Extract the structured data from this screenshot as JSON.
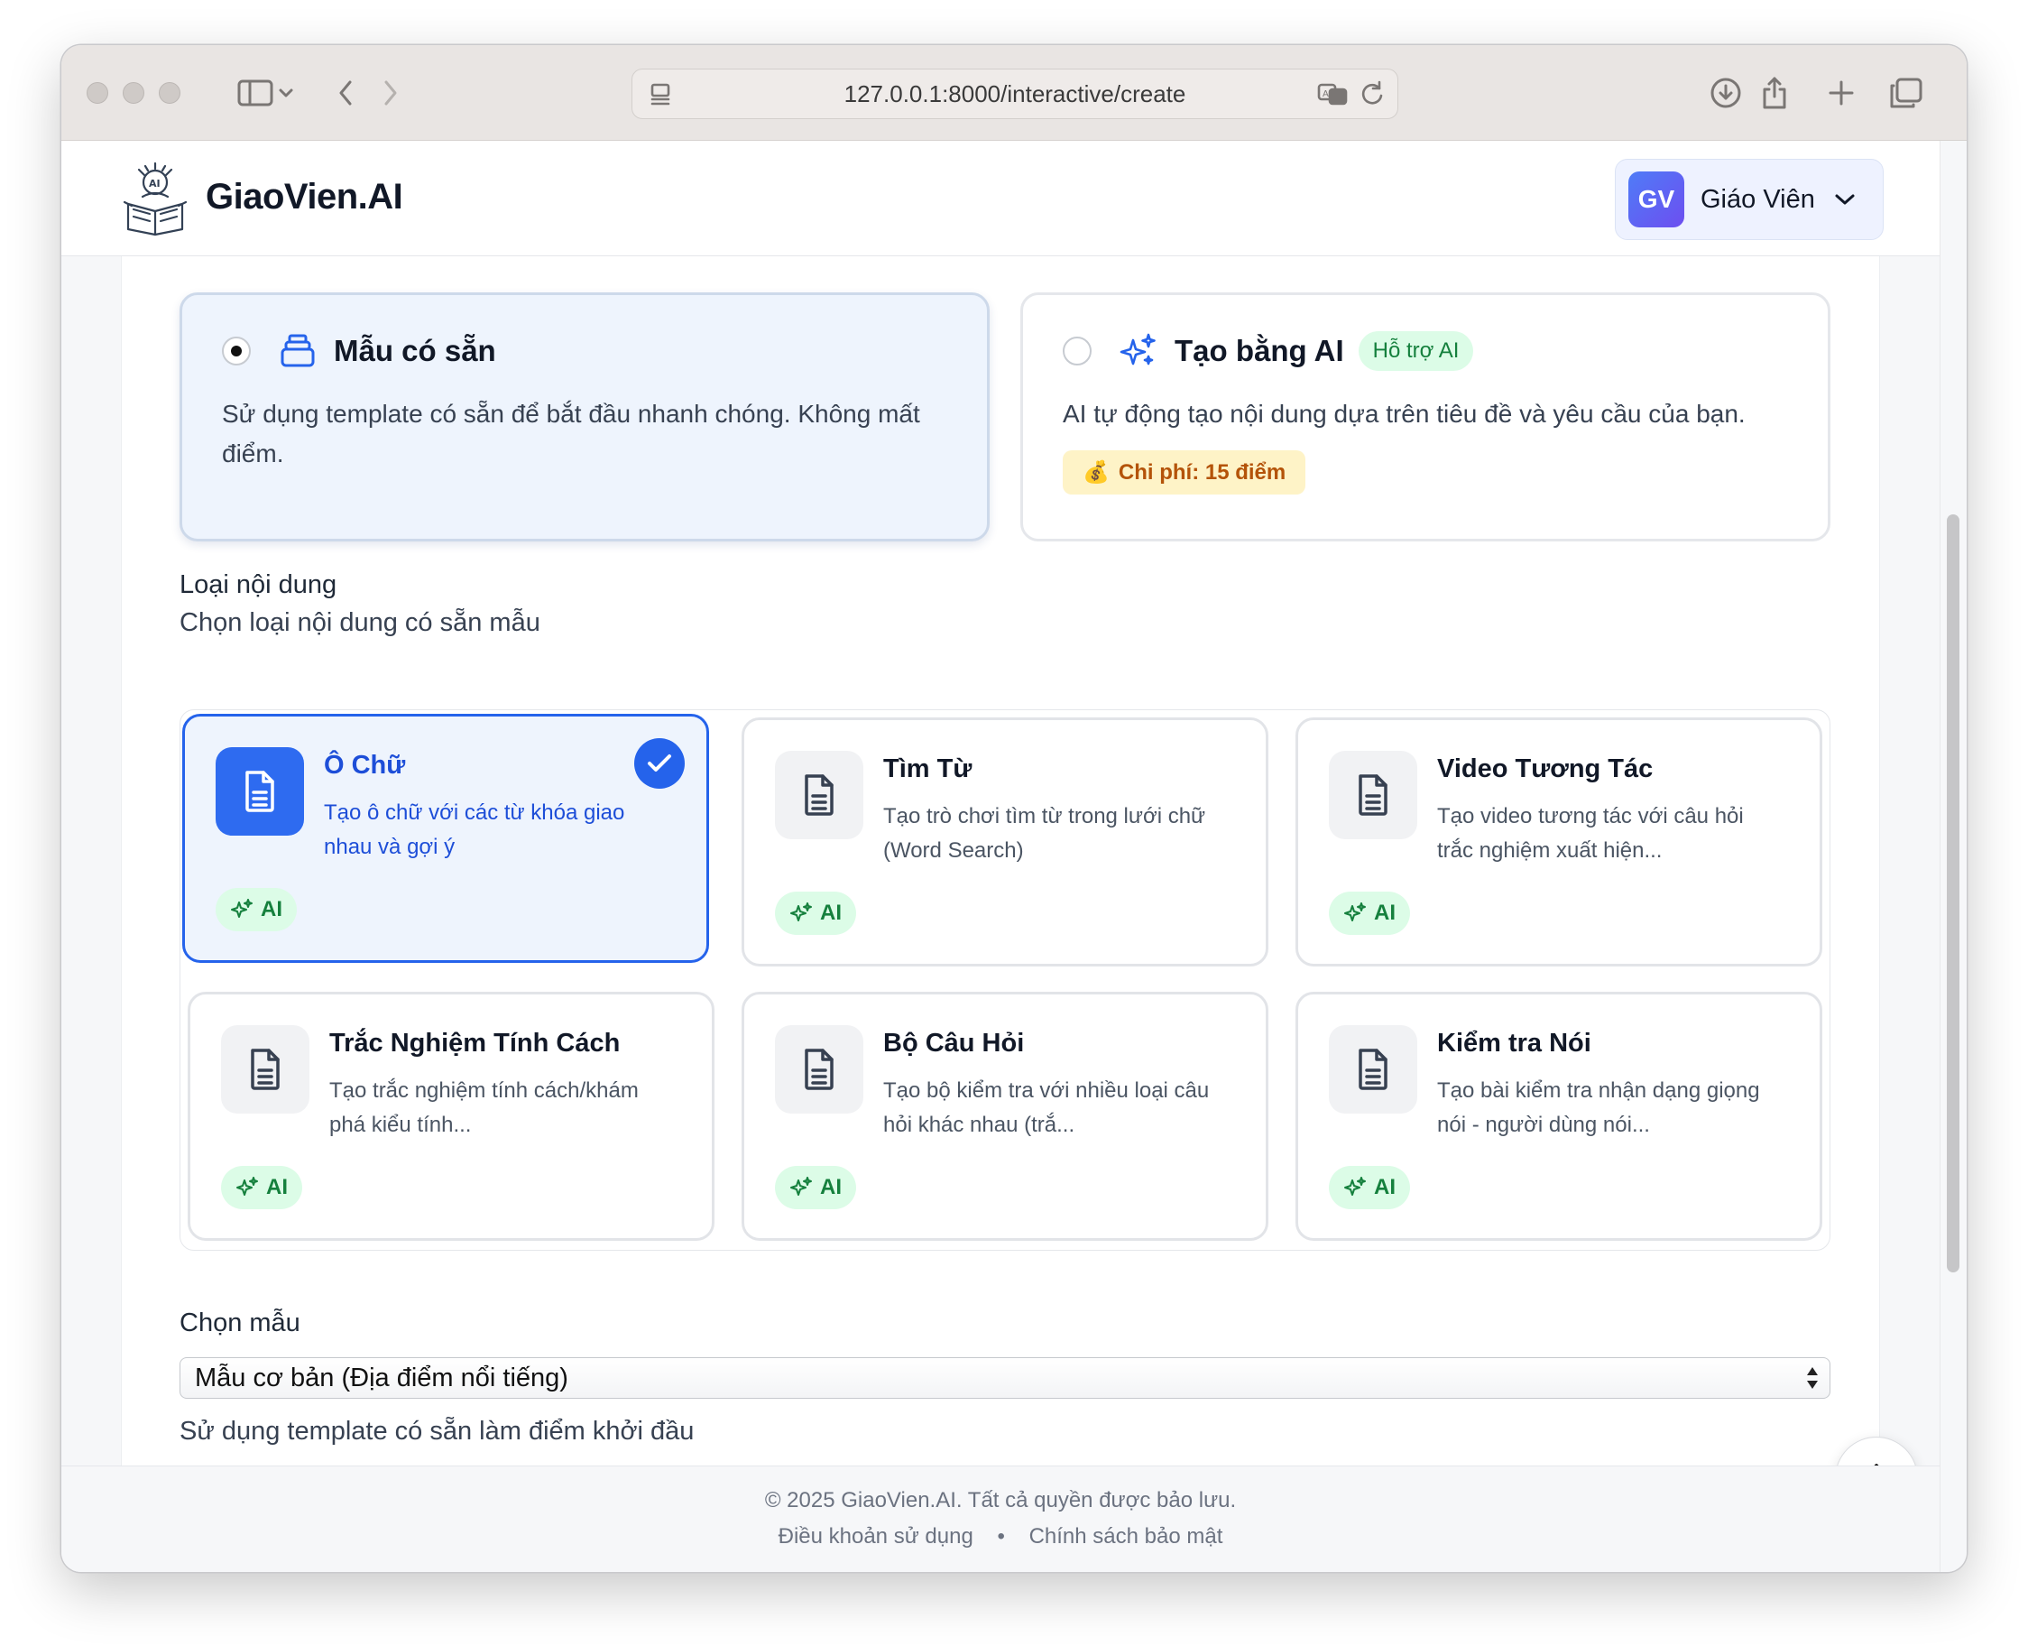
{
  "browser": {
    "url": "127.0.0.1:8000/interactive/create"
  },
  "header": {
    "brand": "GiaoVien.AI",
    "user_initials": "GV",
    "user_name": "Giáo Viên"
  },
  "modes": [
    {
      "title": "Mẫu có sẵn",
      "description": "Sử dụng template có sẵn để bắt đầu nhanh chóng. Không mất điểm.",
      "selected": true
    },
    {
      "title": "Tạo bằng AI",
      "badge": "Hỗ trợ AI",
      "description": "AI tự động tạo nội dung dựa trên tiêu đề và yêu cầu của bạn.",
      "cost": "Chi phí: 15 điểm",
      "cost_icon": "💰",
      "selected": false
    }
  ],
  "content_type": {
    "label": "Loại nội dung",
    "sublabel": "Chọn loại nội dung có sẵn mẫu",
    "items": [
      {
        "title": "Ô Chữ",
        "description": "Tạo ô chữ với các từ khóa giao nhau và gợi ý",
        "tag": "AI",
        "selected": true
      },
      {
        "title": "Tìm Từ",
        "description": "Tạo trò chơi tìm từ trong lưới chữ (Word Search)",
        "tag": "AI",
        "selected": false
      },
      {
        "title": "Video Tương Tác",
        "description": "Tạo video tương tác với câu hỏi trắc nghiệm xuất hiện...",
        "tag": "AI",
        "selected": false
      },
      {
        "title": "Trắc Nghiệm Tính Cách",
        "description": "Tạo trắc nghiệm tính cách/khám phá kiểu tính...",
        "tag": "AI",
        "selected": false
      },
      {
        "title": "Bộ Câu Hỏi",
        "description": "Tạo bộ kiểm tra với nhiều loại câu hỏi khác nhau (trắ...",
        "tag": "AI",
        "selected": false
      },
      {
        "title": "Kiểm tra Nói",
        "description": "Tạo bài kiểm tra nhận dạng giọng nói - người dùng nói...",
        "tag": "AI",
        "selected": false
      }
    ]
  },
  "template_select": {
    "label": "Chọn mẫu",
    "value": "Mẫu cơ bản (Địa điểm nổi tiếng)",
    "hint": "Sử dụng template có sẵn làm điểm khởi đầu"
  },
  "footer": {
    "copyright": "© 2025 GiaoVien.AI. Tất cả quyền được bảo lưu.",
    "terms": "Điều khoản sử dụng",
    "separator": "•",
    "privacy": "Chính sách bảo mật"
  },
  "colors": {
    "accent": "#2563eb",
    "ai_green": "#15803d",
    "cost_amber": "#b45309"
  }
}
